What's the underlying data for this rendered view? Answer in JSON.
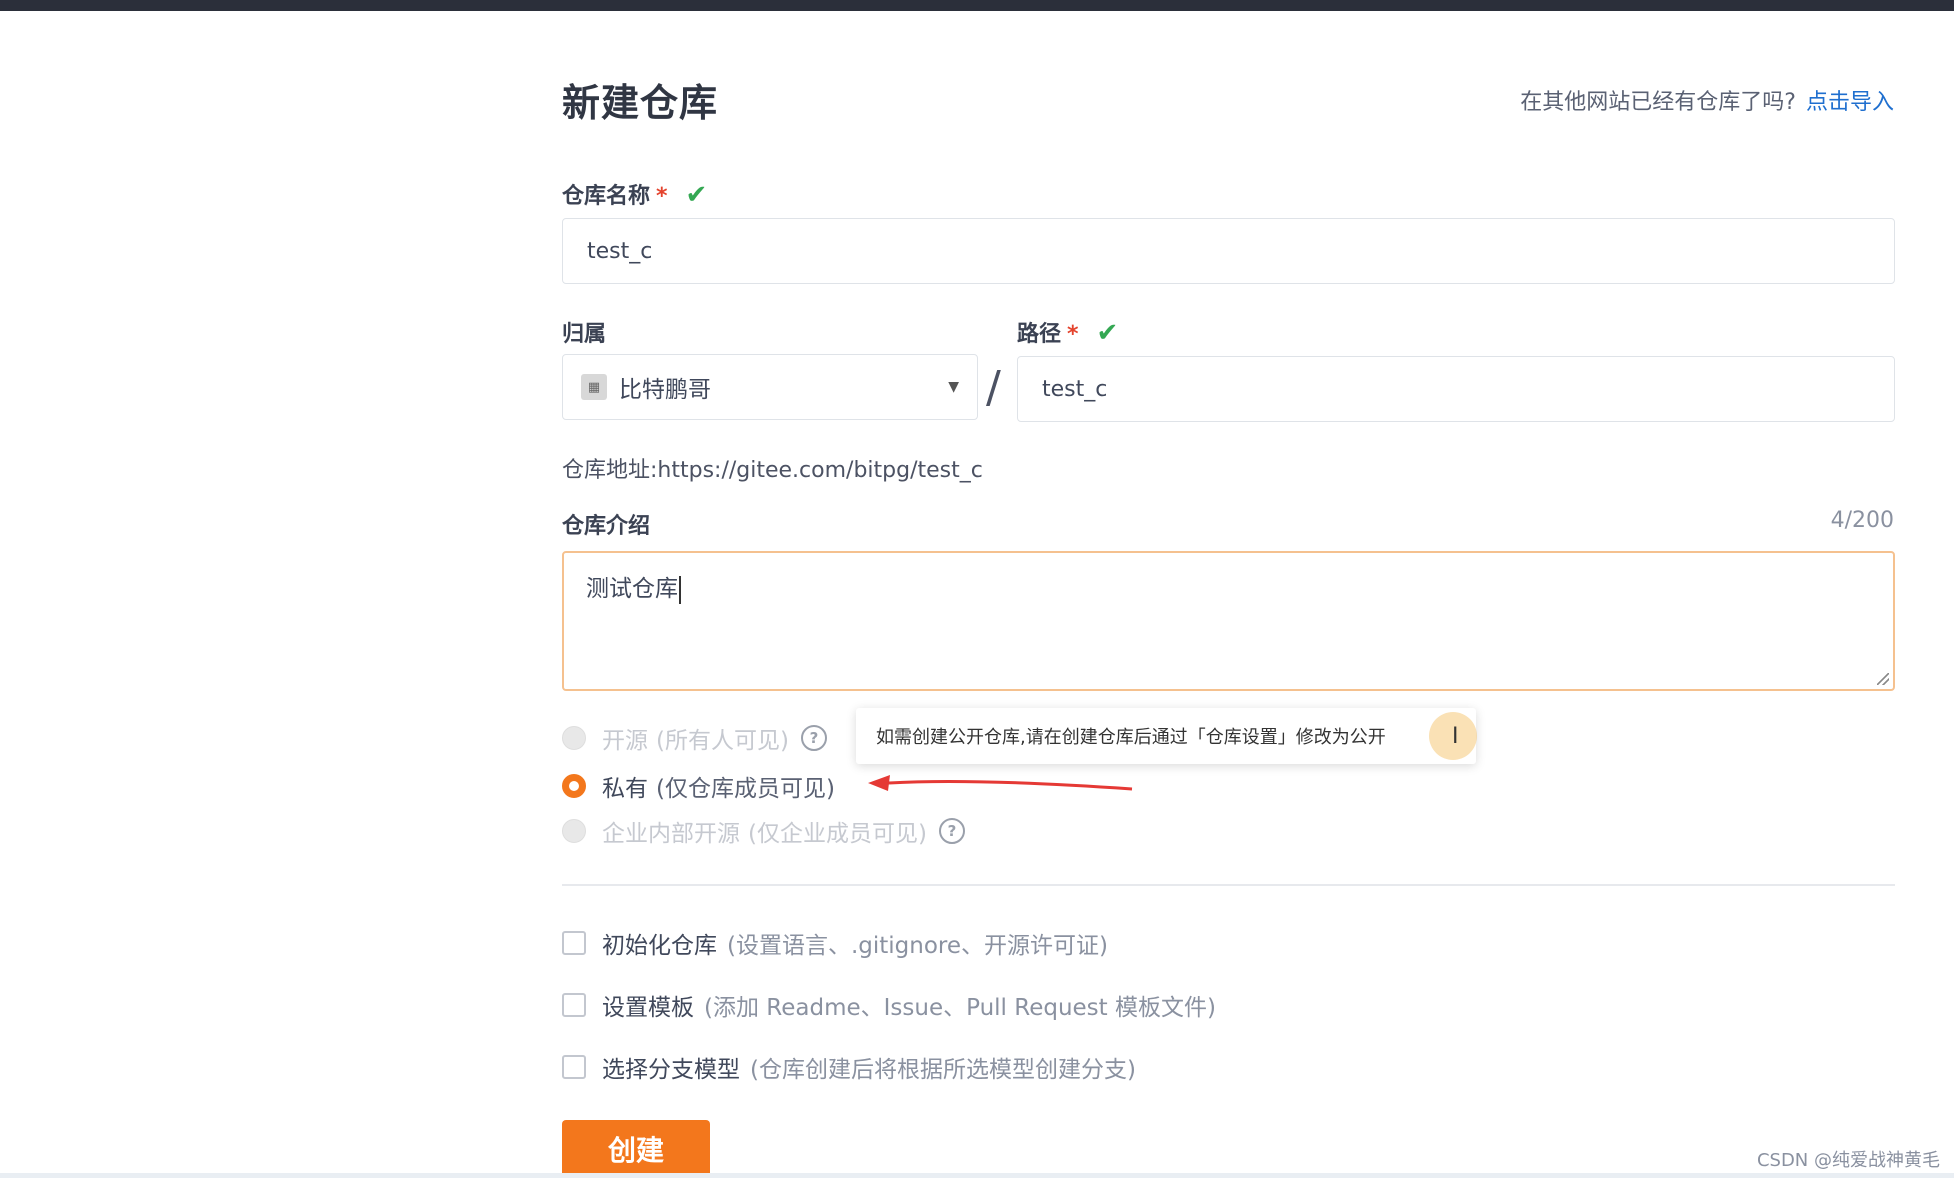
{
  "header": {
    "title": "新建仓库",
    "import_hint": "在其他网站已经有仓库了吗?",
    "import_link": "点击导入"
  },
  "repo_name": {
    "label": "仓库名称",
    "required_mark": "*",
    "value": "test_c"
  },
  "owner": {
    "label": "归属",
    "value": "比特鹏哥"
  },
  "path": {
    "label": "路径",
    "required_mark": "*",
    "value": "test_c",
    "separator": "/"
  },
  "repo_address": {
    "label": "仓库地址:",
    "value": "https://gitee.com/bitpg/test_c"
  },
  "description": {
    "label": "仓库介绍",
    "counter": "4/200",
    "value": "测试仓库"
  },
  "visibility": {
    "options": [
      {
        "label": "开源",
        "sub": "(所有人可见)",
        "selected": false,
        "disabled": true
      },
      {
        "label": "私有",
        "sub": "(仅仓库成员可见)",
        "selected": true,
        "disabled": false
      },
      {
        "label": "企业内部开源",
        "sub": "(仅企业成员可见)",
        "selected": false,
        "disabled": true
      }
    ],
    "tooltip": "如需创建公开仓库,请在创建仓库后通过「仓库设置」修改为公开"
  },
  "options": [
    {
      "label": "初始化仓库",
      "sub": "(设置语言、.gitignore、开源许可证)",
      "checked": false
    },
    {
      "label": "设置模板",
      "sub": "(添加 Readme、Issue、Pull Request 模板文件)",
      "checked": false
    },
    {
      "label": "选择分支模型",
      "sub": "(仓库创建后将根据所选模型创建分支)",
      "checked": false
    }
  ],
  "submit": {
    "label": "创建"
  },
  "watermark": "CSDN @纯爱战神黄毛",
  "colors": {
    "accent": "#f3771c",
    "link": "#1f6fcf",
    "valid": "#34a853",
    "required": "#e4432d",
    "annotation_arrow": "#e53935"
  }
}
